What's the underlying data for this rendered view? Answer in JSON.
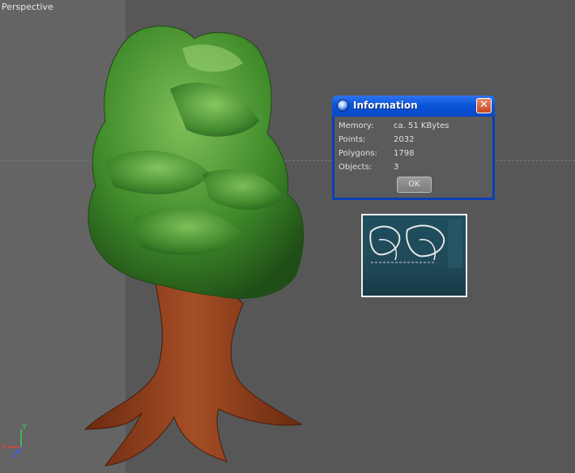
{
  "viewport": {
    "label": "Perspective",
    "axis": {
      "y": "Y",
      "x": "X",
      "z": "Z"
    }
  },
  "dialog": {
    "title": "Information",
    "rows": [
      {
        "key": "Memory:",
        "value": "ca. 51 KBytes"
      },
      {
        "key": "Points:",
        "value": "2032"
      },
      {
        "key": "Polygons:",
        "value": "1798"
      },
      {
        "key": "Objects:",
        "value": "3"
      }
    ],
    "ok_label": "OK",
    "close_glyph": "✕"
  },
  "icons": {
    "title": "globe-icon",
    "close": "close-icon"
  },
  "colors": {
    "viewport_bg": "#575757",
    "titlebar": "#0b55d9",
    "close": "#c9461f"
  }
}
